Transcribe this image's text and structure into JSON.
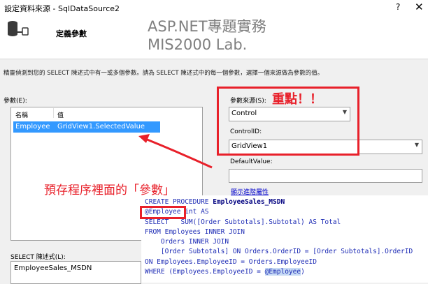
{
  "window": {
    "title": "設定資料來源 - SqlDataSource2",
    "help": "?",
    "close": "✕"
  },
  "header": {
    "step_title": "定義參數"
  },
  "watermark": {
    "line1": "ASP.NET專題實務",
    "line2": "MIS2000 Lab."
  },
  "instructions": "精靈偵測到您的 SELECT 陳述式中有一或多個參數。請為 SELECT 陳述式中的每一個參數，選擇一個來源做為參數的值。",
  "parameters": {
    "label": "參數(E):",
    "columns": [
      "名稱",
      "值"
    ],
    "rows": [
      {
        "name": "Employee",
        "value": "GridView1.SelectedValue"
      }
    ]
  },
  "parameter_source": {
    "label": "參數來源(S):",
    "value": "Control"
  },
  "control_id": {
    "label": "ControlID:",
    "value": "GridView1"
  },
  "default_value": {
    "label": "DefaultValue:",
    "value": ""
  },
  "advanced_link": "顯示進階屬性",
  "annotations": {
    "emphasis": "重點！！",
    "callout": "預存程序裡面的「參數」"
  },
  "select_statement": {
    "label": "SELECT 陳述式(L):",
    "value": "EmployeeSales_MSDN"
  },
  "code": {
    "lines": [
      "CREATE PROCEDURE EmployeeSales_MSDN",
      "@Employee int AS",
      "SELECT   SUM([Order Subtotals].Subtotal) AS Total",
      "FROM Employees INNER JOIN",
      "    Orders INNER JOIN",
      "    [Order Subtotals] ON Orders.OrderID = [Order Subtotals].OrderID",
      "ON Employees.EmployeeID = Orders.EmployeeID",
      "WHERE (Employees.EmployeeID = @Employee)"
    ]
  },
  "colors": {
    "annotation_red": "#e8202a",
    "selection_blue": "#3399ff",
    "link_blue": "#0000cc",
    "code_blue": "#1d2bb5"
  }
}
